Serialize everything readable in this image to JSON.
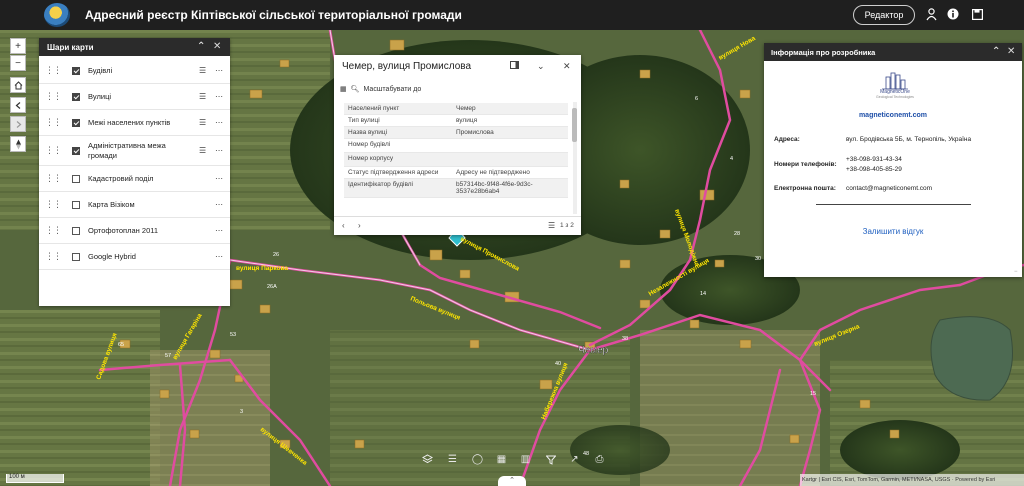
{
  "header": {
    "title": "Адресний реєстр Кіптівської сільської територіальної громади",
    "editor_button": "Редактор",
    "icons": [
      "person-icon",
      "info-icon",
      "save-icon"
    ]
  },
  "map_controls": {
    "zoom_in": "+",
    "zoom_out": "−",
    "icons": [
      "home-icon",
      "back-icon",
      "forward-icon",
      "compass-icon"
    ]
  },
  "layers_panel": {
    "title": "Шари карти",
    "layers": [
      {
        "name": "Будівлі",
        "checked": true,
        "has_legend": true
      },
      {
        "name": "Вулиці",
        "checked": true,
        "has_legend": true
      },
      {
        "name": "Межі населених пунктів",
        "checked": true,
        "has_legend": true
      },
      {
        "name": "Адміністративна межа громади",
        "checked": true,
        "has_legend": true
      },
      {
        "name": "Кадастровий поділ",
        "checked": false,
        "has_legend": false
      },
      {
        "name": "Карта Візіком",
        "checked": false,
        "has_legend": false
      },
      {
        "name": "Ортофотоплан 2011",
        "checked": false,
        "has_legend": false
      },
      {
        "name": "Google Hybrid",
        "checked": false,
        "has_legend": false
      }
    ]
  },
  "popup": {
    "title": "Чемер, вулиця Промислова",
    "zoom_to": "Масштабувати до",
    "attributes": [
      {
        "key": "Населений пункт",
        "value": "Чемер"
      },
      {
        "key": "Тип вулиці",
        "value": "вулиця"
      },
      {
        "key": "Назва вулиці",
        "value": "Промислова"
      },
      {
        "key": "Номер будівлі",
        "value": ""
      },
      {
        "key": "Номер корпусу",
        "value": ""
      },
      {
        "key": "Статус підтвердження адреси",
        "value": "Адресу не підтверджено"
      },
      {
        "key": "Ідентифікатор будівлі",
        "value": "b57314bc-9f48-4f6e-9d3c-3537e28b6ab4"
      }
    ],
    "pager": "1 з 2"
  },
  "info_panel": {
    "title": "Інформація про розробника",
    "logo_text": "MagneticOne",
    "logo_subtext": "Geological Technologies",
    "website": "magneticonemt.com",
    "address_label": "Адреса:",
    "address_value": "вул. Бродівська 5Б, м. Тернопіль, Україна",
    "phones_label": "Номери телефонів:",
    "phone_1": "+38-098-931-43-34",
    "phone_2": "+38-098-405-85-29",
    "email_label": "Електронна пошта:",
    "email_value": "contact@magneticonemt.com",
    "feedback": "Залишити відгук"
  },
  "map_labels": {
    "village": "Чемер",
    "streets": [
      "вулиця Паркова",
      "вулиця Промислова",
      "вулиця Озерна",
      "Садова вулиця",
      "вулиця Гагаріна",
      "вулиця Молодіжна",
      "Незалежності вулиця",
      "Польова вулиця",
      "Набережна вулиця",
      "вулиця Шевченка",
      "вулиця Нова"
    ],
    "house_numbers": [
      "26",
      "26А",
      "65",
      "57",
      "53",
      "3",
      "38",
      "40",
      "14",
      "28",
      "30",
      "4",
      "6",
      "48",
      "15"
    ]
  },
  "bottom_toolbar": {
    "icons": [
      "layers-icon",
      "list-icon",
      "measure-icon",
      "basemap-icon",
      "table-icon",
      "filter-icon",
      "share-icon",
      "print-icon"
    ]
  },
  "scale_label": "100 м",
  "attribution": "Kartgr | Esri CIS, Esri, TomTom, Garmin, METI/NASA, USGS · Powered by Esri"
}
